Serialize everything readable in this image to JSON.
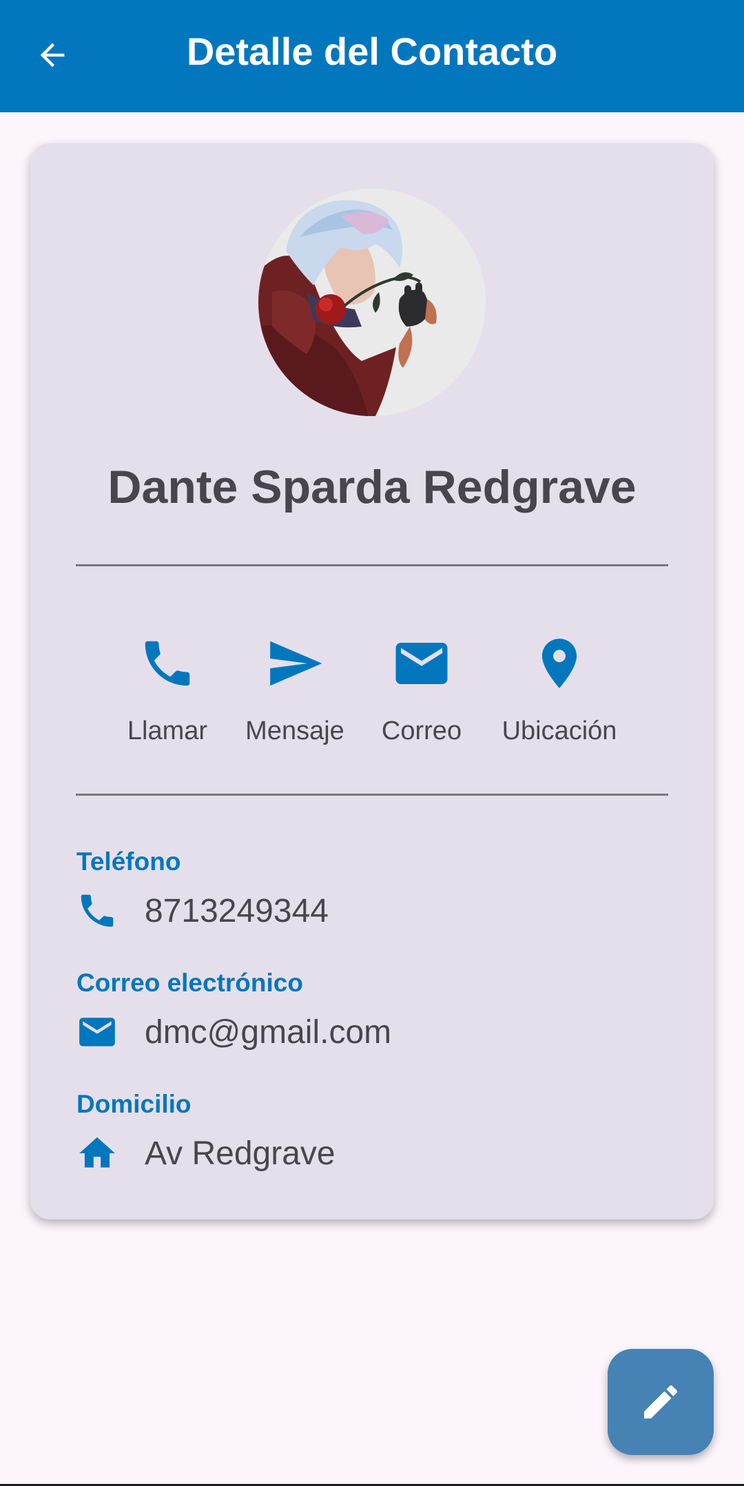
{
  "appbar": {
    "title": "Detalle del Contacto",
    "back_icon": "arrow-left-icon",
    "color": "#0277bd"
  },
  "contact": {
    "name": "Dante Sparda Redgrave",
    "avatar_icon": "contact-avatar-image"
  },
  "actions": [
    {
      "label": "Llamar",
      "icon": "phone-icon"
    },
    {
      "label": "Mensaje",
      "icon": "send-icon"
    },
    {
      "label": "Correo",
      "icon": "mail-icon"
    },
    {
      "label": "Ubicación",
      "icon": "location-pin-icon"
    }
  ],
  "fields": {
    "phone": {
      "label": "Teléfono",
      "value": "8713249344",
      "icon": "phone-icon"
    },
    "email": {
      "label": "Correo electrónico",
      "value": "dmc@gmail.com",
      "icon": "mail-icon"
    },
    "address": {
      "label": "Domicilio",
      "value": "Av Redgrave",
      "icon": "home-icon"
    }
  },
  "fab": {
    "icon": "edit-pencil-icon",
    "color": "#4682b4"
  },
  "colors": {
    "accent": "#0277bd",
    "card": "#e5dfeb",
    "background": "#fcf6fc",
    "text": "#49454f"
  }
}
